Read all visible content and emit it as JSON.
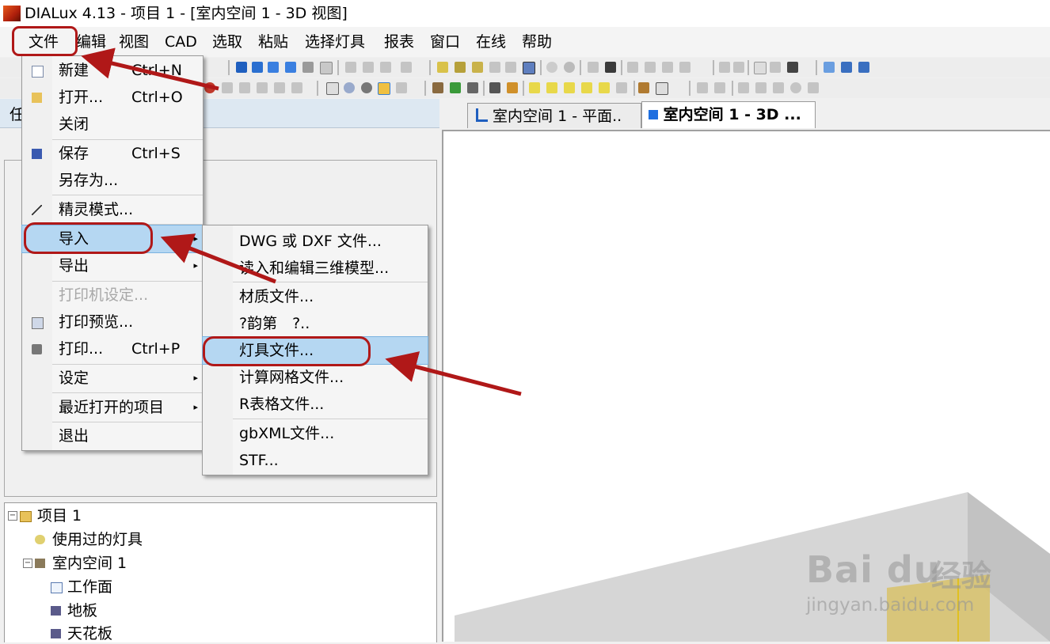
{
  "window": {
    "title": "DIALux 4.13 - 项目 1 - [室内空间 1 - 3D 视图]"
  },
  "menubar": {
    "items": [
      {
        "label": "文件"
      },
      {
        "label": "编辑"
      },
      {
        "label": "视图"
      },
      {
        "label": "CAD"
      },
      {
        "label": "选取"
      },
      {
        "label": "粘贴"
      },
      {
        "label": "选择灯具"
      },
      {
        "label": "报表"
      },
      {
        "label": "窗口"
      },
      {
        "label": "在线"
      },
      {
        "label": "帮助"
      }
    ]
  },
  "left_panel": {
    "strip_label": "任"
  },
  "tabs": [
    {
      "label": "室内空间 1 - 平面..",
      "active": false,
      "icon": "floor-plan-icon"
    },
    {
      "label": "室内空间 1 - 3D ...",
      "active": true,
      "icon": "3d-cube-icon"
    }
  ],
  "file_menu": {
    "items": [
      {
        "label": "新建",
        "shortcut": "Ctrl+N",
        "icon": "new-document-icon"
      },
      {
        "label": "打开...",
        "shortcut": "Ctrl+O",
        "icon": "open-folder-icon"
      },
      {
        "label": "关闭"
      },
      {
        "label": "保存",
        "shortcut": "Ctrl+S",
        "icon": "save-disk-icon"
      },
      {
        "label": "另存为..."
      },
      {
        "label": "精灵模式...",
        "icon": "wizard-wand-icon"
      },
      {
        "label": "导入",
        "submenu": true,
        "highlighted": true
      },
      {
        "label": "导出",
        "submenu": true
      },
      {
        "label": "打印机设定...",
        "disabled": true
      },
      {
        "label": "打印预览...",
        "icon": "print-preview-icon"
      },
      {
        "label": "打印...",
        "shortcut": "Ctrl+P",
        "icon": "printer-icon"
      },
      {
        "label": "设定",
        "submenu": true
      },
      {
        "label": "最近打开的项目",
        "submenu": true
      },
      {
        "label": "退出"
      }
    ],
    "submenu_arrow": "▸"
  },
  "import_submenu": {
    "items": [
      {
        "label": "DWG 或 DXF 文件..."
      },
      {
        "label": "读入和编辑三维模型..."
      },
      {
        "label": "材质文件..."
      },
      {
        "label": "?韵第　?.."
      },
      {
        "label": "灯具文件...",
        "highlighted": true
      },
      {
        "label": "计算网格文件..."
      },
      {
        "label": "R表格文件..."
      },
      {
        "label": "gbXML文件..."
      },
      {
        "label": "STF..."
      }
    ]
  },
  "tree": {
    "items": [
      {
        "label": "项目 1",
        "icon": "folder-icon"
      },
      {
        "label": "使用过的灯具",
        "icon": "luminaires-icon"
      },
      {
        "label": "室内空间 1",
        "icon": "room-icon"
      },
      {
        "label": "工作面",
        "icon": "workplane-icon"
      },
      {
        "label": "地板",
        "icon": "floor-icon"
      },
      {
        "label": "天花板",
        "icon": "ceiling-icon"
      }
    ],
    "expander_minus": "−"
  },
  "watermark": {
    "brand": "Bai du",
    "cn": "经验",
    "url": "jingyan.baidu.com"
  },
  "colors": {
    "annotation_red": "#b01818",
    "highlight": "#b5d7f2",
    "title_icon": "#d2411a"
  }
}
